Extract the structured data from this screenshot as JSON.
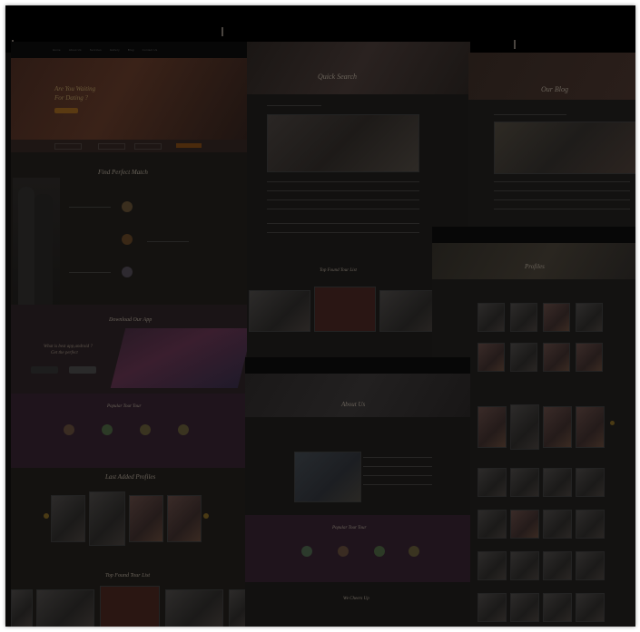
{
  "nav": {
    "items": [
      "Home",
      "About Us",
      "Services",
      "Gallery",
      "Blog",
      "Contact Us"
    ]
  },
  "hero": {
    "title_line1": "Are You Waiting",
    "title_line2": "For Dating ?",
    "button_label": "Read More"
  },
  "sections": {
    "quick_search": "Quick Search",
    "our_blog": "Our Blog",
    "download_app": "Download Our App",
    "app_tagline_1": "What is best app,android ?",
    "app_tagline_2": "Get the perfect",
    "popular_tour": "Popular Tour Tour",
    "last_added_profiles": "Last Added Profiles",
    "top_found": "Top Found Tour List",
    "profiles": "Profiles",
    "about_us": "About Us",
    "we_cheers": "We Cheers Up",
    "find_perfect_match": "Find Perfect Match"
  },
  "colors": {
    "background": "#0a0908",
    "accent_gold": "#6b5a3a",
    "accent_orange": "#a06a1a"
  }
}
